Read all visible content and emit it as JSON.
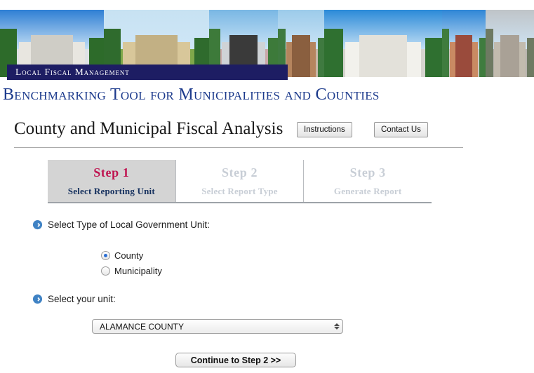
{
  "banner": {
    "label": "Local Fiscal Management",
    "photos": [
      {
        "name": "nc-state-capitol",
        "sky": "#2f7fd4",
        "ground": "#dfe2e4",
        "building": "#e8e6e0",
        "roof": "#cfcdc6",
        "trees": "#2d6b2a",
        "width": 148
      },
      {
        "name": "courthouse-with-flowers",
        "sky": "#c7e2f2",
        "ground": "#7fa84a",
        "building": "#d8c79a",
        "roof": "#c2b084",
        "trees": "#2f6b2d",
        "width": 150
      },
      {
        "name": "domed-courthouse",
        "sky": "#79b7e4",
        "ground": "#c9a8a8",
        "building": "#cfd3d6",
        "roof": "#3a3a3a",
        "trees": "#3d7a3a",
        "width": 98
      },
      {
        "name": "brick-city-hall",
        "sky": "#9ccbea",
        "ground": "#c8b8a8",
        "building": "#b5855e",
        "roof": "#8a5f3f",
        "trees": "#3f7a40",
        "width": 66
      },
      {
        "name": "nc-legislative-building",
        "sky": "#2b8ad8",
        "ground": "#d6d4cf",
        "building": "#f2f1ec",
        "roof": "#e3e1da",
        "trees": "#2f7030",
        "width": 168
      },
      {
        "name": "asheville-city-hall",
        "sky": "#2f86d6",
        "ground": "#cfcac2",
        "building": "#c98a63",
        "roof": "#9a4b3c",
        "trees": "#3f7c3e",
        "width": 62
      },
      {
        "name": "stone-office-building",
        "sky": "#bfc4c8",
        "ground": "#b8b4ae",
        "building": "#c2bbae",
        "roof": "#a9a196",
        "trees": "#6e7a62",
        "width": 69
      }
    ]
  },
  "subtitle": "Benchmarking Tool for Municipalities and Counties",
  "header": {
    "page_title": "County and Municipal Fiscal Analysis",
    "instructions_label": "Instructions",
    "contact_label": "Contact Us"
  },
  "steps": [
    {
      "number": "Step 1",
      "label": "Select Reporting Unit",
      "state": "active"
    },
    {
      "number": "Step 2",
      "label": "Select Report Type",
      "state": "muted"
    },
    {
      "number": "Step 3",
      "label": "Generate Report",
      "state": "muted"
    }
  ],
  "form": {
    "type_prompt": "Select Type of Local Government Unit:",
    "unit_prompt": "Select your unit:",
    "options": [
      {
        "label": "County",
        "selected": true
      },
      {
        "label": "Municipality",
        "selected": false
      }
    ],
    "unit_value": "ALAMANCE COUNTY",
    "continue_label": "Continue to Step 2 >>"
  },
  "colors": {
    "navy": "#1d1d63",
    "subtitle_blue": "#1c3a8c",
    "active_step_crimson": "#bf1450",
    "active_step_navy": "#15305e",
    "muted_step": "#c8ced6",
    "arrow_blue": "#3f82c4",
    "radio_dot": "#2b6fd4"
  }
}
